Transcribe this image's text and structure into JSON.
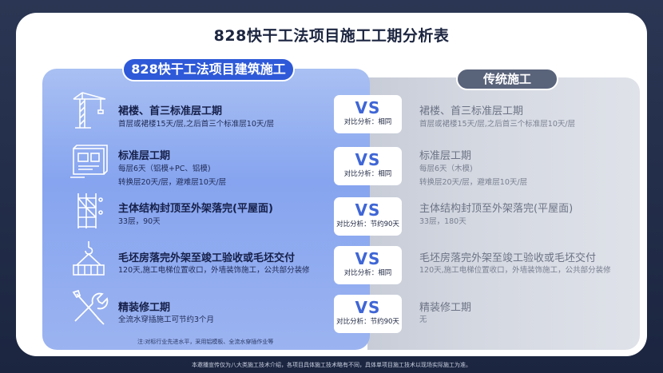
{
  "title": "828快干工法项目施工工期分析表",
  "left_header": "828快干工法项目建筑施工",
  "right_header": "传统施工",
  "vs_label": "VS",
  "rows": [
    {
      "icon": "tower-crane-icon",
      "left_title": "裙楼、首三标准层工期",
      "left_lines": [
        "首层或裙楼15天/层,之后首三个标准层10天/层"
      ],
      "compare": "对比分析：相同",
      "right_title": "裙楼、首三标准层工期",
      "right_lines": [
        "首层或裙楼15天/层,之后首三个标准层10天/层"
      ]
    },
    {
      "icon": "blueprint-icon",
      "left_title": "标准层工期",
      "left_lines": [
        "每层6天（铝模+PC、铝模)",
        "转换层20天/层，避难层10天/层"
      ],
      "compare": "对比分析：相同",
      "right_title": "标准层工期",
      "right_lines": [
        "每层6天（木模)",
        "转换层20天/层，避难层10天/层"
      ]
    },
    {
      "icon": "scaffold-icon",
      "left_title": "主体结构封顶至外架落完(平屋面)",
      "left_lines": [
        "33层，90天"
      ],
      "compare": "对比分析：节约90天",
      "right_title": "主体结构封顶至外架落完(平屋面)",
      "right_lines": [
        "33层，180天"
      ]
    },
    {
      "icon": "hook-load-icon",
      "left_title": "毛坯房落完外架至竣工验收或毛坯交付",
      "left_lines": [
        "120天,施工电梯位置收口，外墙装饰施工，公共部分装修"
      ],
      "compare": "对比分析：相同",
      "right_title": "毛坯房落完外架至竣工验收或毛坯交付",
      "right_lines": [
        "120天,施工电梯位置收口，外墙装饰施工，公共部分装修"
      ]
    },
    {
      "icon": "tools-icon",
      "left_title": "精装修工期",
      "left_lines": [
        "全流水穿插施工可节约3个月"
      ],
      "compare": "对比分析：节约90天",
      "right_title": "精装修工期",
      "right_lines": [
        "无"
      ]
    }
  ],
  "footnote": "注:对标行业先进水平，采用铝模板、全流水穿插作业等",
  "disclaimer": "本邀播宣传仅为八大类施工技术介绍，各项目具体施工技术略有不同，具体单项目施工技术以现场实际施工为准。"
}
